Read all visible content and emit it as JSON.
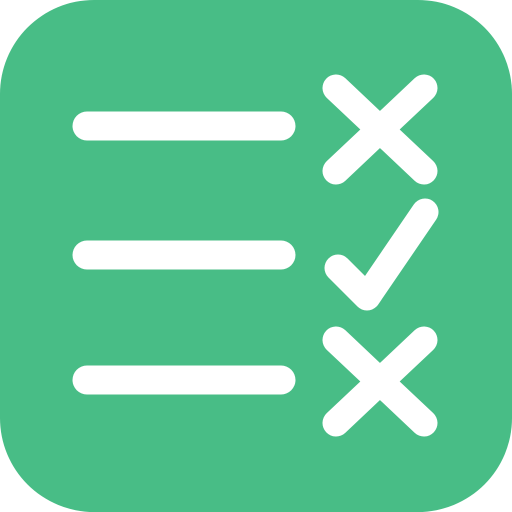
{
  "app_icon": {
    "icon_name": "checklist-icon",
    "background_color": "#48BD86",
    "foreground_color": "#FFFFFF",
    "rows": [
      {
        "line": "list-line",
        "mark": "cross-mark-icon"
      },
      {
        "line": "list-line",
        "mark": "check-mark-icon"
      },
      {
        "line": "list-line",
        "mark": "cross-mark-icon"
      }
    ]
  }
}
